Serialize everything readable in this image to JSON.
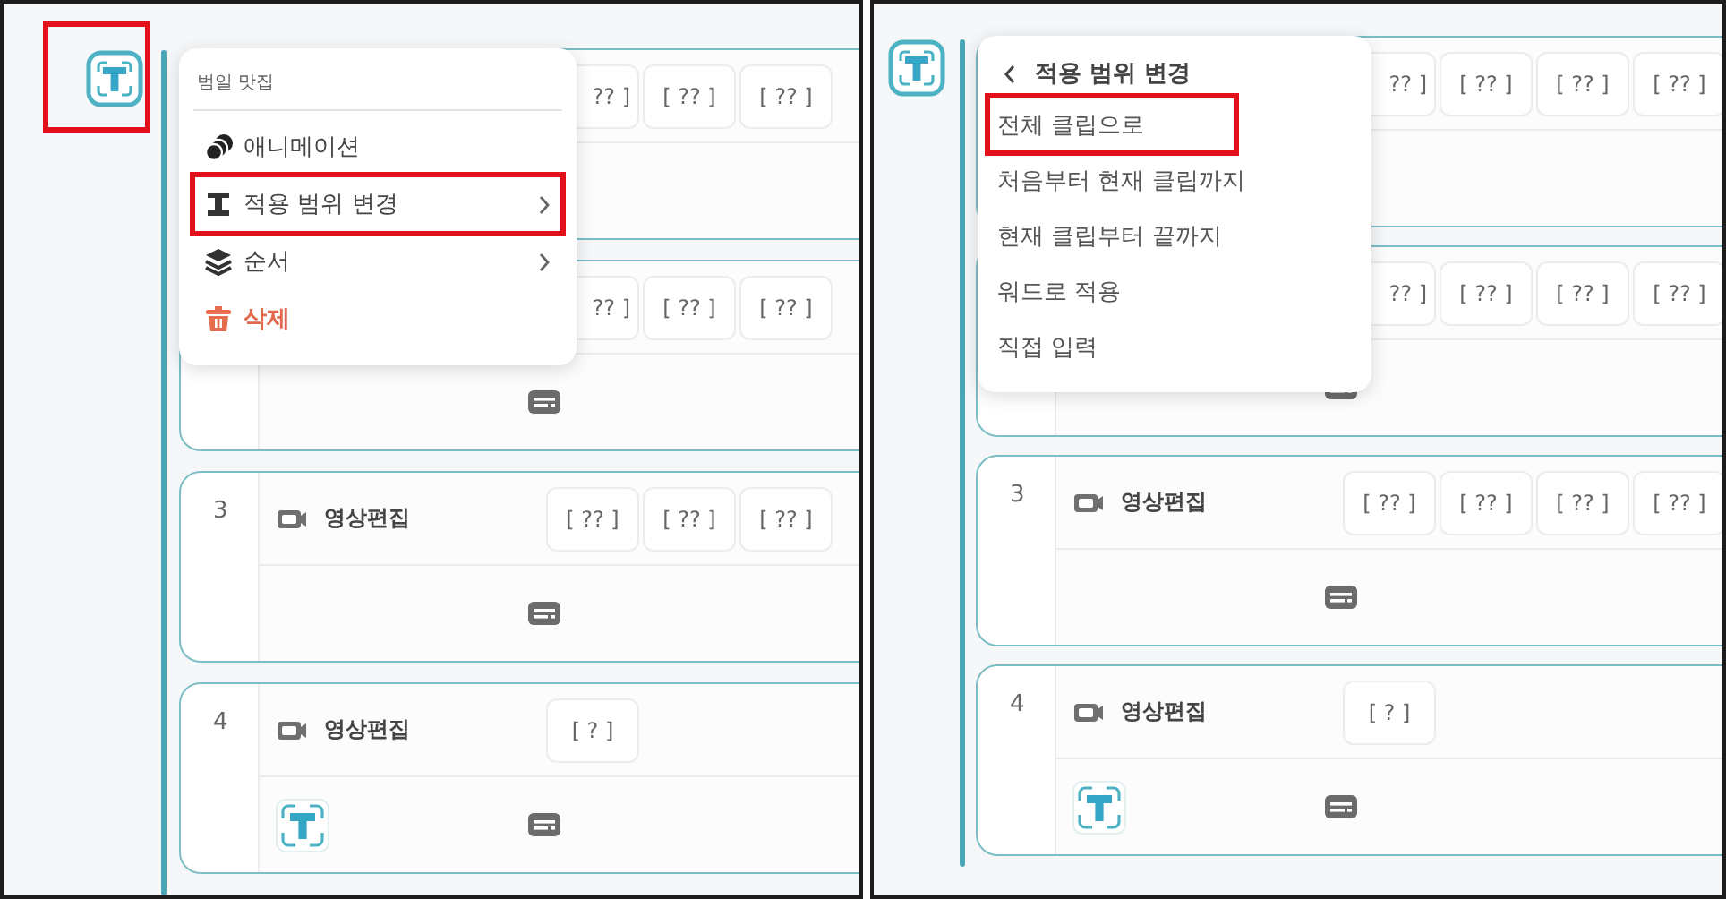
{
  "panels": [
    {
      "launcher": {
        "highlighted": true
      },
      "cards": [
        {
          "chips": [
            "?? ]",
            "[ ?? ]",
            "[ ?? ]"
          ]
        },
        {
          "chips": [
            "?? ]",
            "[ ?? ]",
            "[ ?? ]"
          ],
          "caption_button": true
        },
        {
          "number": "3",
          "title": "영상편집",
          "chips": [
            "[ ?? ]",
            "[ ?? ]",
            "[ ?? ]"
          ],
          "caption_button": true
        },
        {
          "number": "4",
          "title": "영상편집",
          "chips": [
            "[ ? ]"
          ],
          "text_clip": true,
          "caption_button": true
        }
      ],
      "menu": {
        "kind": "main",
        "header": "범일 맛집",
        "items": [
          {
            "label": "애니메이션",
            "submenu": false,
            "danger": false,
            "highlighted": false
          },
          {
            "label": "적용 범위 변경",
            "submenu": true,
            "danger": false,
            "highlighted": true
          },
          {
            "label": "순서",
            "submenu": true,
            "danger": false,
            "highlighted": false
          },
          {
            "label": "삭제",
            "submenu": false,
            "danger": true,
            "highlighted": false
          }
        ]
      }
    },
    {
      "cards": [
        {
          "chips": [
            "?? ]",
            "[ ?? ]",
            "[ ?? ]",
            "[ ?? ]"
          ]
        },
        {
          "chips": [
            "?? ]",
            "[ ?? ]",
            "[ ?? ]",
            "[ ?? ]"
          ],
          "caption_button": true
        },
        {
          "number": "3",
          "title": "영상편집",
          "chips": [
            "[ ?? ]",
            "[ ?? ]",
            "[ ?? ]",
            "[ ?? ]"
          ],
          "caption_button": true
        },
        {
          "number": "4",
          "title": "영상편집",
          "chips": [
            "[ ? ]"
          ],
          "text_clip": true,
          "caption_button": true
        }
      ],
      "menu": {
        "kind": "submenu",
        "title": "적용 범위 변경",
        "items": [
          {
            "label": "전체 클립으로",
            "submenu": false,
            "danger": false,
            "highlighted": true
          },
          {
            "label": "처음부터 현재 클립까지",
            "submenu": false,
            "danger": false,
            "highlighted": false
          },
          {
            "label": "현재 클립부터 끝까지",
            "submenu": false,
            "danger": false,
            "highlighted": false
          },
          {
            "label": "워드로 적용",
            "submenu": false,
            "danger": false,
            "highlighted": false
          },
          {
            "label": "직접 입력",
            "submenu": false,
            "danger": false,
            "highlighted": false
          }
        ]
      }
    }
  ]
}
